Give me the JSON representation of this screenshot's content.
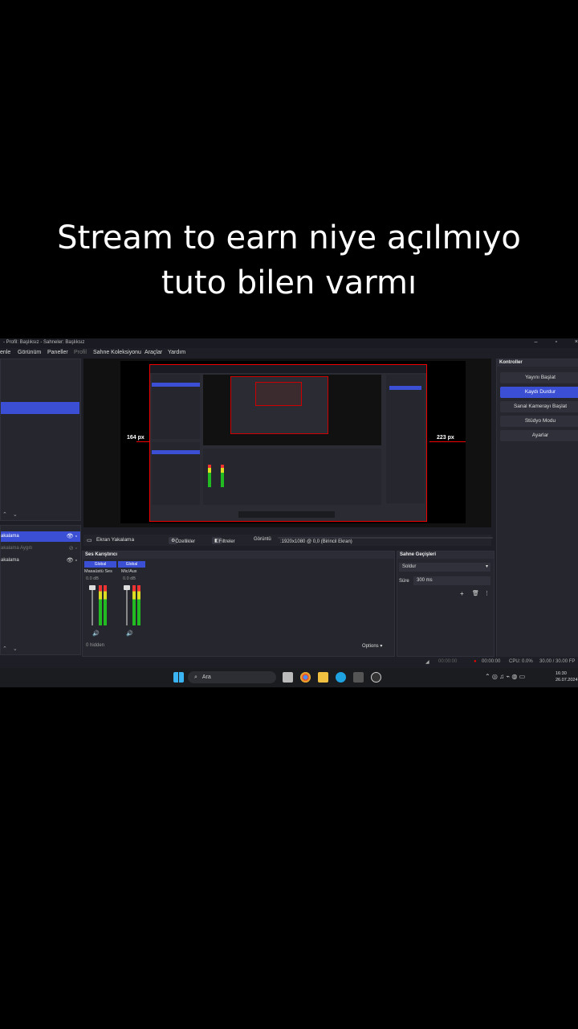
{
  "caption": {
    "line1": "Stream to earn niye açılmıyo",
    "line2": "tuto bilen varmı"
  },
  "obs": {
    "window_title": "- Profil: Başlıksız - Sahneler: Başlıksız",
    "menu": [
      "enle",
      "Görünüm",
      "Paneller",
      "Profil",
      "Sahne Koleksiyonu",
      "Araçlar",
      "Yardım"
    ],
    "preview": {
      "left_margin_label": "164 px",
      "right_margin_label": "223 px"
    },
    "sources": [
      {
        "label": "akalama",
        "selected": true
      },
      {
        "label": "akalama Aygıtı",
        "selected": false
      },
      {
        "label": "akalama",
        "selected": false
      }
    ],
    "source_toolbar": {
      "source_name": "Ekran Yakalama",
      "properties_label": "Özellikler",
      "filters_label": "Filtreler",
      "display_label": "Görüntü",
      "display_value": ":1920x1080 @ 0,0 (Birincil Ekran)"
    },
    "mixer": {
      "title": "Ses Karıştırıcı",
      "channels": [
        {
          "badge": "Global",
          "name": "Masaüstü Ses",
          "db": "0.0 dB"
        },
        {
          "badge": "Global",
          "name": "Mic/Aux",
          "db": "0.0 dB"
        }
      ],
      "hidden_label": "0 hidden",
      "options_label": "Options"
    },
    "transitions": {
      "title": "Sahne Geçişleri",
      "type": "Soldur",
      "duration_label": "Süre",
      "duration_value": "300 ms"
    },
    "controls": {
      "title": "Kontroller",
      "buttons": [
        {
          "label": "Yayını Başlat",
          "active": false
        },
        {
          "label": "Kaydı Durdur",
          "active": true
        },
        {
          "label": "Sanal Kamerayı Başlat",
          "active": false
        },
        {
          "label": "Stüdyo Modu",
          "active": false
        },
        {
          "label": "Ayarlar",
          "active": false
        }
      ]
    },
    "status": {
      "rec_time": "00:00:00",
      "stream_time": "00:00:00",
      "cpu": "CPU: 0.0%",
      "fps": "30.00 / 30.00 FP"
    }
  },
  "taskbar": {
    "search_placeholder": "Ara",
    "time": "16:30",
    "date": "26.07.2024"
  },
  "colors": {
    "accent": "#3a4fd4",
    "record_red": "#e00000",
    "panel_bg": "#25262e"
  }
}
